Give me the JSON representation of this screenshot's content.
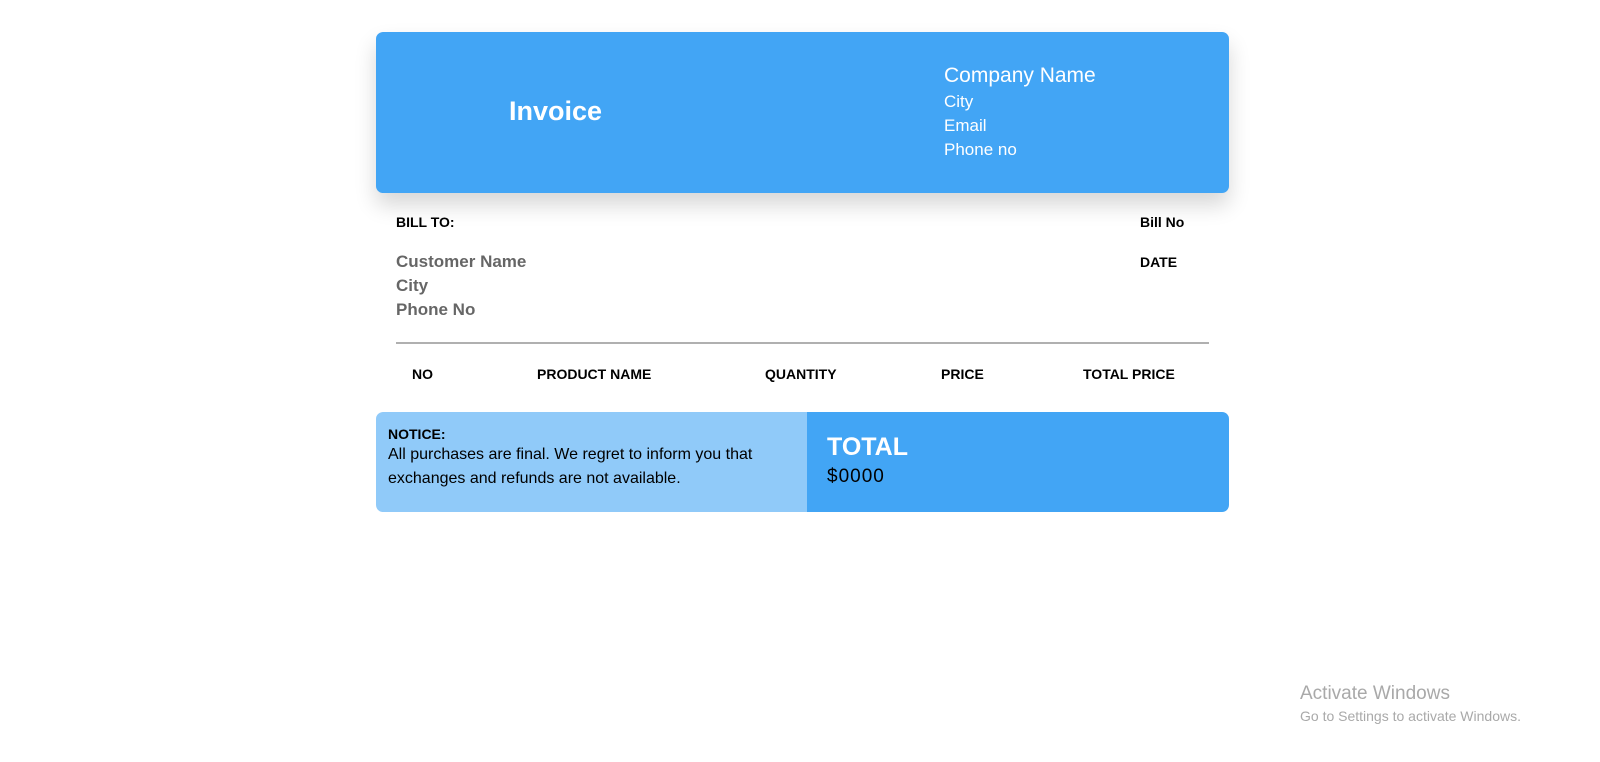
{
  "header": {
    "title": "Invoice",
    "company_name": "Company Name",
    "company_city": "City",
    "company_email": "Email",
    "company_phone": "Phone no"
  },
  "billing": {
    "bill_to_label": "BILL TO:",
    "customer_name": "Customer Name",
    "customer_city": "City",
    "customer_phone": "Phone No",
    "bill_no_label": "Bill No",
    "date_label": "DATE"
  },
  "table": {
    "columns": [
      "NO",
      "PRODUCT NAME",
      "QUANTITY",
      "PRICE",
      "TOTAL PRICE"
    ]
  },
  "footer": {
    "notice_label": "NOTICE:",
    "notice_text": "All purchases are final. We regret to inform you that exchanges and refunds are not available.",
    "total_label": "TOTAL",
    "total_value": "$0000"
  },
  "watermark": {
    "title": "Activate Windows",
    "subtitle": "Go to Settings to activate Windows."
  },
  "colors": {
    "primary": "#42a5f5",
    "light": "#90caf9"
  }
}
